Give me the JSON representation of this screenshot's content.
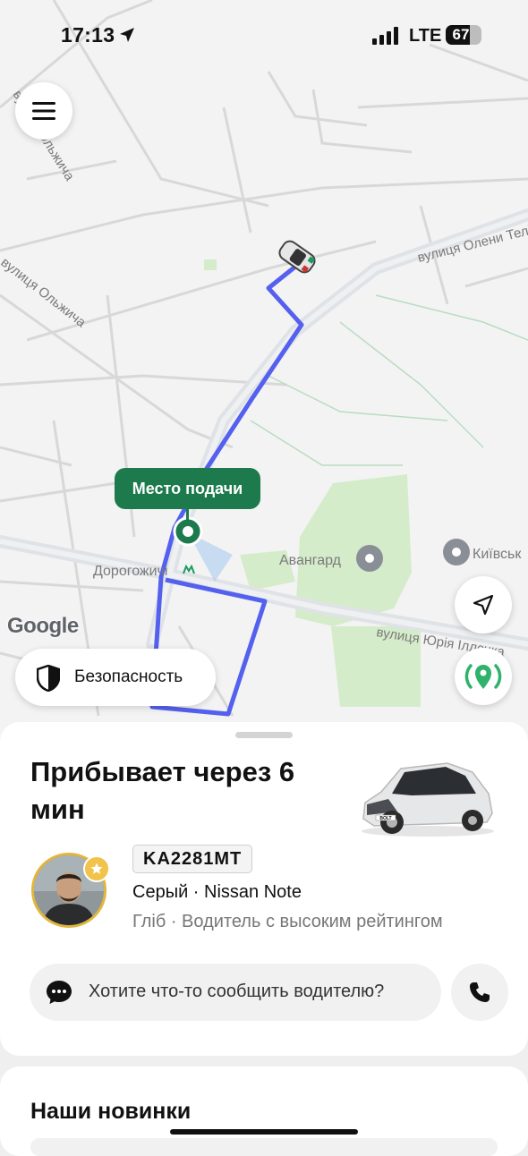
{
  "status_bar": {
    "time": "17:13",
    "network": "LTE",
    "battery": "67",
    "battery_level": 0.67
  },
  "map": {
    "streets": {
      "olzhycha_1": "вулиця Ольжича",
      "olzhycha_2": "вулиця Ольжича",
      "olzhycha_3": "вулиця Ольжича",
      "oleny_telihy": "вулиця Олени Телігі",
      "yuriya_illenka": "вулиця Юрія Іллєнка"
    },
    "places": {
      "avangard": "Авангард",
      "kyivsk": "Київськ",
      "dorohozhychi": "Дорогожичі"
    },
    "pickup_label": "Место подачи",
    "attribution": "Google",
    "colors": {
      "route": "#5460ee",
      "pickup": "#1c7a4c",
      "park": "#cfe8c4"
    }
  },
  "safety_button": {
    "label": "Безопасность"
  },
  "trip": {
    "eta": "Прибывает через 6 мин",
    "plate": "KA2281MT",
    "car": "Серый · Nissan Note",
    "driver": "Гліб · Водитель с высоким рейтингом",
    "car_badge": "BOLT"
  },
  "message": {
    "placeholder": "Хотите что-то сообщить водителю?"
  },
  "news": {
    "title": "Наши новинки"
  },
  "icons": {
    "menu": "menu-icon",
    "navigate": "navigation-arrow-icon",
    "share_location": "location-share-icon",
    "shield": "shield-icon",
    "chat": "chat-bubble-icon",
    "phone": "phone-icon"
  }
}
